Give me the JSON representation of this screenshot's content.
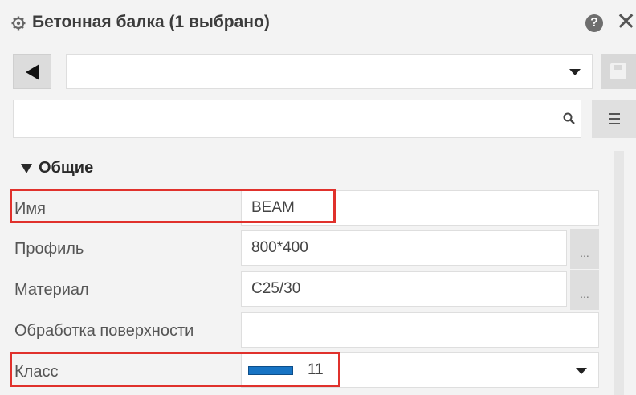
{
  "panel": {
    "title": "Бетонная балка (1 выбрано)",
    "help_icon_label": "?",
    "close_icon_label": "✕"
  },
  "toolbar": {
    "preset_value": "",
    "search_placeholder": ""
  },
  "section": {
    "title": "Общие"
  },
  "properties": [
    {
      "label": "Имя",
      "value": "BEAM"
    },
    {
      "label": "Профиль",
      "value": "800*400",
      "button": "..."
    },
    {
      "label": "Материал",
      "value": "C25/30",
      "button": "..."
    },
    {
      "label": "Обработка поверхности",
      "value": ""
    },
    {
      "label": "Класс",
      "value": "11",
      "swatch_color": "#1874c4"
    }
  ],
  "colors": {
    "highlight": "#e0312c",
    "background": "#f3f3f3"
  }
}
